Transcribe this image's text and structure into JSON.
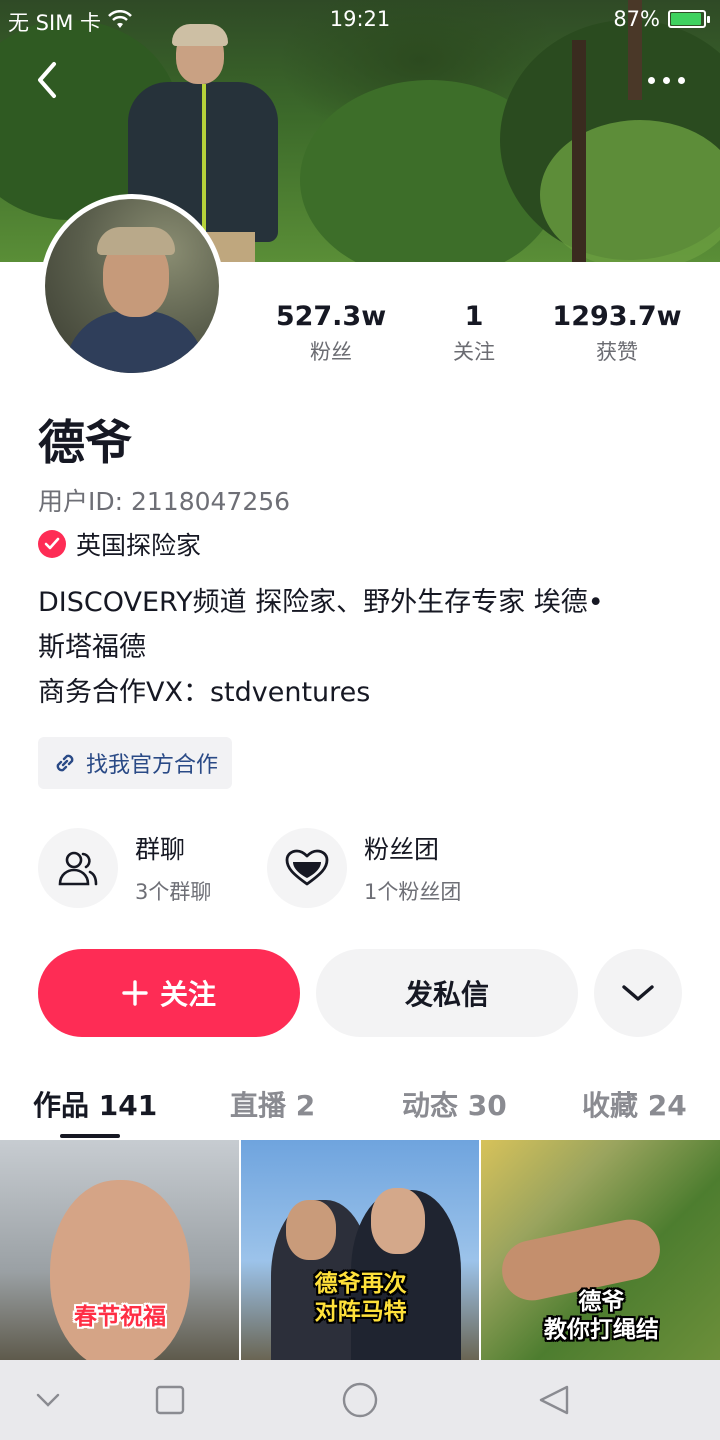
{
  "status_bar": {
    "carrier": "无 SIM 卡",
    "time": "19:21",
    "battery_percent": "87%",
    "battery_level": 0.87
  },
  "header": {
    "back_icon": "chevron-left-icon",
    "more_icon": "more-dots-icon"
  },
  "profile": {
    "name": "德爷",
    "user_id": "用户ID: 2118047256",
    "verification": "英国探险家",
    "bio_lines": [
      "DISCOVERY频道 探险家、野外生存专家 埃德•",
      "斯塔福德",
      "商务合作VX：stdventures"
    ],
    "official_link": "找我官方合作"
  },
  "stats": [
    {
      "value": "527.3w",
      "label": "粉丝"
    },
    {
      "value": "1",
      "label": "关注"
    },
    {
      "value": "1293.7w",
      "label": "获赞"
    }
  ],
  "groups": [
    {
      "title": "群聊",
      "subtitle": "3个群聊",
      "icon": "group-chat-icon"
    },
    {
      "title": "粉丝团",
      "subtitle": "1个粉丝团",
      "icon": "heart-icon"
    }
  ],
  "actions": {
    "follow_label": "关注",
    "message_label": "发私信",
    "more_icon": "chevron-down-icon"
  },
  "tabs": [
    {
      "label": "作品 141",
      "active": true
    },
    {
      "label": "直播 2",
      "active": false
    },
    {
      "label": "动态 30",
      "active": false
    },
    {
      "label": "收藏 24",
      "active": false
    }
  ],
  "videos": [
    {
      "caption": "春节祝福"
    },
    {
      "caption_lines": [
        "德爷再次",
        "对阵马特"
      ]
    },
    {
      "caption_lines": [
        "德爷",
        "教你打绳结"
      ]
    }
  ],
  "navbar": {
    "icons": [
      "collapse-chevron-icon",
      "home-square-icon",
      "home-circle-icon",
      "back-triangle-icon"
    ]
  },
  "colors": {
    "accent": "#fe2c55",
    "text": "#161823",
    "secondary_text": "#6e6f76"
  }
}
